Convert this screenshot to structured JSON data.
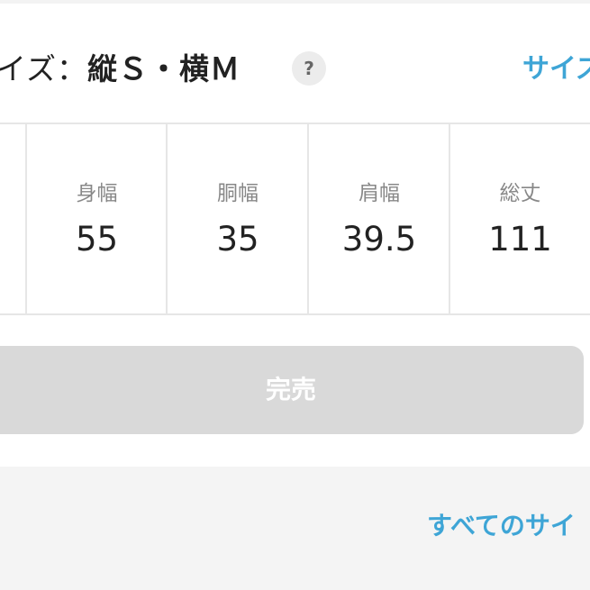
{
  "header": {
    "size_label": "イズ：",
    "size_value": "縦Ｓ・横Ｍ",
    "help_icon": "question-icon",
    "help_glyph": "?",
    "size_link": "サイズ"
  },
  "measurements": [
    {
      "name": "身幅",
      "value": "55"
    },
    {
      "name": "胴幅",
      "value": "35"
    },
    {
      "name": "肩幅",
      "value": "39.5"
    },
    {
      "name": "総丈",
      "value": "111"
    }
  ],
  "purchase": {
    "soldout_label": "完売"
  },
  "footer": {
    "all_sizes_link": "すべてのサイ"
  },
  "colors": {
    "accent": "#3ea5d6",
    "button_disabled": "#d9d9d9",
    "panel_bg": "#f4f4f4",
    "border": "#e6e6e6"
  }
}
